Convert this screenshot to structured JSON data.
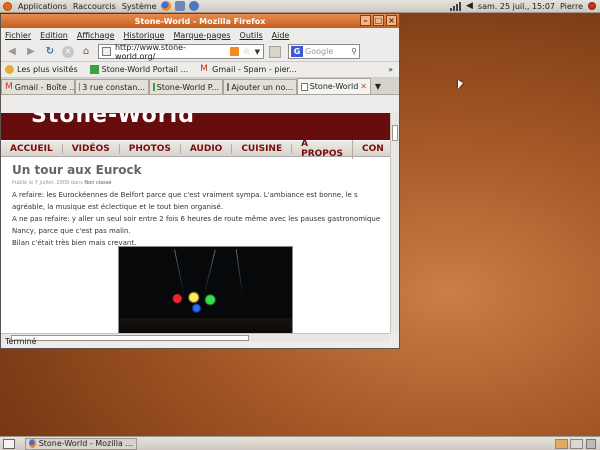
{
  "top_panel": {
    "menus": [
      "Applications",
      "Raccourcis",
      "Système"
    ],
    "datetime": "sam. 25 juil., 15:07",
    "user": "Pierre"
  },
  "window": {
    "title": "Stone-World - Mozilla Firefox",
    "menu": [
      "Fichier",
      "Edition",
      "Affichage",
      "Historique",
      "Marque-pages",
      "Outils",
      "Aide"
    ],
    "url": "http://www.stone-world.org/",
    "search_placeholder": "Google",
    "bookmarks": [
      {
        "label": "Les plus visités",
        "icon": "gear-icon"
      },
      {
        "label": "Stone-World Portail ...",
        "icon": "site-icon"
      },
      {
        "label": "Gmail - Spam - pier...",
        "icon": "gmail-icon"
      }
    ],
    "tabs": [
      {
        "label": "Gmail - Boîte ...",
        "icon": "gmail-icon",
        "active": false
      },
      {
        "label": "3 rue constan...",
        "icon": "maps-icon",
        "active": false
      },
      {
        "label": "Stone-World P...",
        "icon": "site-icon",
        "active": false
      },
      {
        "label": "Ajouter un no...",
        "icon": "page-icon",
        "active": false
      },
      {
        "label": "Stone-World",
        "icon": "page-icon",
        "active": true
      }
    ],
    "status": "Terminé"
  },
  "page": {
    "logo": "Stone-World",
    "nav": [
      "ACCUEIL",
      "VIDÉOS",
      "PHOTOS",
      "AUDIO",
      "CUISINE",
      "À PROPOS",
      "CON"
    ],
    "article": {
      "title": "Un tour aux Eurock",
      "meta_prefix": "Publié le 7 juillet, 2009 dans",
      "meta_category": "Non classé",
      "lines": [
        "A refaire: les Eurockéennes de Belfort parce que c'est vraiment sympa. L'ambiance est bonne, le s",
        "agréable, la musique est éclectique et le tout bien organisé.",
        "A ne pas refaire: y aller un seul soir entre 2 fois 6 heures de route même avec les pauses gastronomique",
        "Nancy, parce que c'est pas malin.",
        "Bilan c'était très bien mais crevant."
      ]
    }
  },
  "taskbar": {
    "task": "Stone-World - Mozilla ..."
  }
}
